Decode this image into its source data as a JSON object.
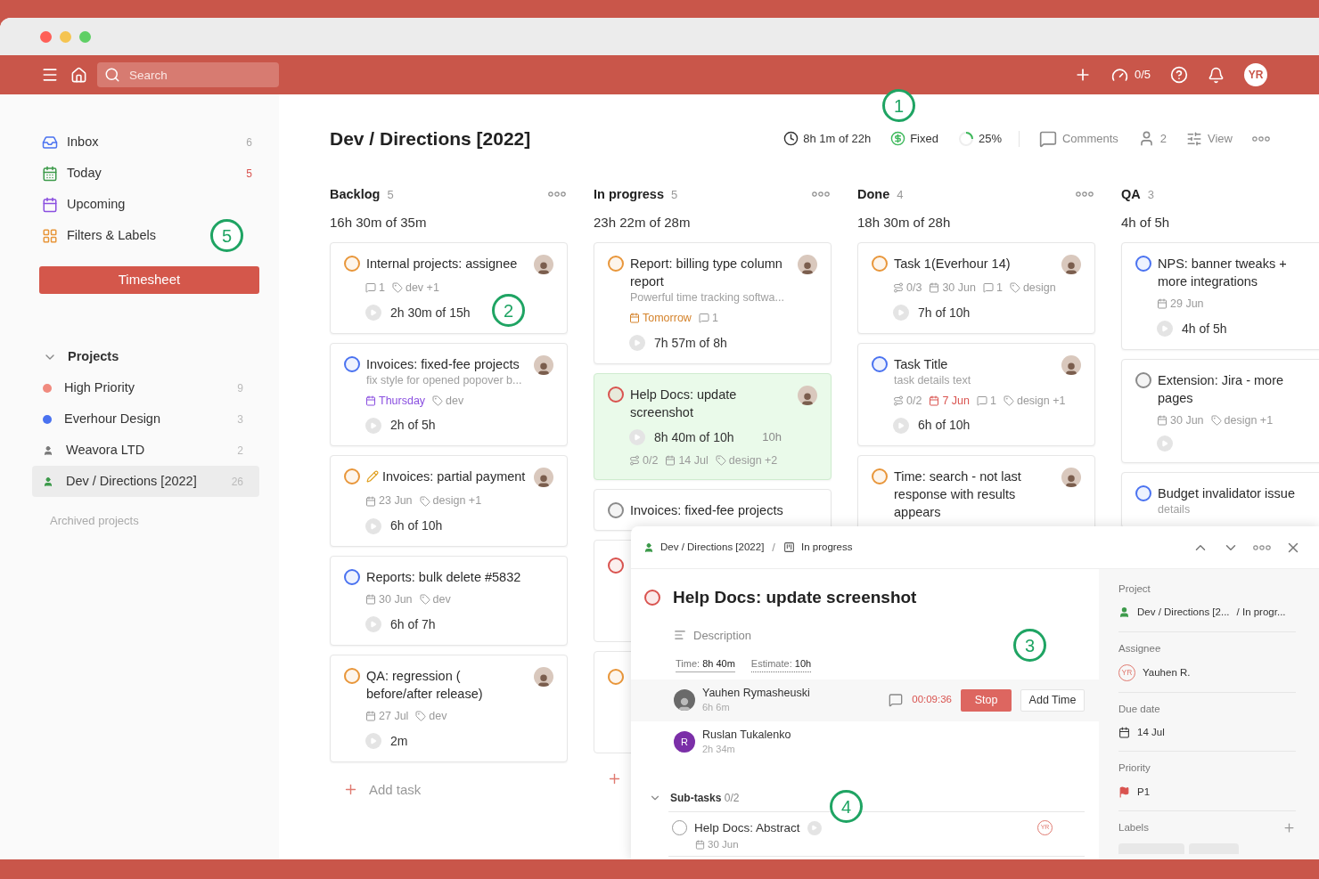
{
  "header": {
    "search_placeholder": "Search",
    "timers": "0/5",
    "avatar": "YR"
  },
  "sidebar": {
    "items": [
      {
        "kind": "inbox",
        "label": "Inbox",
        "count": "6",
        "alert": false
      },
      {
        "kind": "today",
        "label": "Today",
        "count": "5",
        "alert": true
      },
      {
        "kind": "upcoming",
        "label": "Upcoming"
      },
      {
        "kind": "filters",
        "label": "Filters & Labels"
      }
    ],
    "button": "Timesheet",
    "projects": {
      "title": "Projects",
      "expanded": true,
      "items": [
        {
          "kind": "dot",
          "label": "High Priority",
          "count": "9",
          "color": "#f08a7e",
          "selected": false
        },
        {
          "kind": "dot",
          "label": "Everhour Design",
          "count": "3",
          "color": "#4a72f0",
          "selected": false
        },
        {
          "kind": "person",
          "label": "Weavora LTD",
          "count": "2",
          "color": "#7a7a7a",
          "selected": false
        },
        {
          "kind": "person",
          "label": "Dev / Directions [2022]",
          "count": "26",
          "color": "#3c9a4a",
          "selected": true
        }
      ]
    },
    "archived": "Archived projects"
  },
  "project": {
    "title": "Dev / Directions [2022]",
    "stats": [
      {
        "kind": "time",
        "text": "8h 1m of 22h"
      },
      {
        "kind": "billing",
        "text": "Fixed"
      },
      {
        "kind": "progress",
        "text": "25%",
        "level": 0.25
      },
      {
        "kind": "comments",
        "text": "Comments"
      },
      {
        "kind": "members",
        "text": "2"
      },
      {
        "kind": "view",
        "text": "View"
      }
    ]
  },
  "columns": [
    {
      "title": "Backlog",
      "count": "5",
      "total": "16h 30m of 35m",
      "add_label": "Add task",
      "cards": [
        {
          "kind": "meta-first",
          "title": "Internal projects: assignee",
          "color": "#e8963a",
          "selected": false,
          "assigned": true,
          "meta": [
            {
              "kind": "comments",
              "text": "1"
            },
            {
              "kind": "tag",
              "text": "dev +1"
            }
          ],
          "timer": true,
          "time": "2h 30m of 15h"
        },
        {
          "kind": "meta-first",
          "title": "Invoices: fixed-fee projects",
          "subtitle": "fix style for opened popover b...",
          "color": "#4a72f0",
          "selected": false,
          "assigned": true,
          "meta": [
            {
              "kind": "date",
              "text": "Thursday",
              "color": "#8a4fe0"
            },
            {
              "kind": "tag",
              "text": "dev"
            }
          ],
          "timer": true,
          "time": "2h of 5h"
        },
        {
          "kind": "meta-first",
          "title": "Invoices: partial payment",
          "edited": true,
          "color": "#e8963a",
          "selected": false,
          "assigned": true,
          "meta": [
            {
              "kind": "date",
              "text": "23 Jun"
            },
            {
              "kind": "tag",
              "text": "design +1"
            }
          ],
          "timer": true,
          "time": "6h of 10h"
        },
        {
          "kind": "meta-first",
          "title": "Reports: bulk delete #5832",
          "color": "#4a72f0",
          "selected": false,
          "assigned": false,
          "meta": [
            {
              "kind": "date",
              "text": "30 Jun"
            },
            {
              "kind": "tag",
              "text": "dev"
            }
          ],
          "timer": true,
          "time": "6h of 7h"
        },
        {
          "kind": "meta-first",
          "title": "QA: regression ( before/after release)",
          "color": "#e8963a",
          "selected": false,
          "assigned": true,
          "meta": [
            {
              "kind": "date",
              "text": "27 Jul"
            },
            {
              "kind": "tag",
              "text": "dev"
            }
          ],
          "timer": true,
          "time": "2m"
        }
      ]
    },
    {
      "title": "In progress",
      "count": "5",
      "total": "23h 22m of 28m",
      "cards": [
        {
          "kind": "meta-first",
          "title": "Report: billing type column report",
          "subtitle": "Powerful time tracking softwa...",
          "color": "#e8963a",
          "selected": false,
          "assigned": true,
          "meta": [
            {
              "kind": "date",
              "text": "Tomorrow",
              "color": "#d4822a"
            },
            {
              "kind": "comments",
              "text": "1"
            }
          ],
          "timer": true,
          "time": "7h 57m of 8h"
        },
        {
          "kind": "timer-first",
          "title": "Help Docs: update screenshot",
          "color": "#d9534f",
          "selected": true,
          "assigned": true,
          "timer": true,
          "time": "8h 40m of 10h",
          "estimate": "10h",
          "meta": [
            {
              "kind": "subtasks",
              "text": "0/2"
            },
            {
              "kind": "date",
              "text": "14 Jul"
            },
            {
              "kind": "tag",
              "text": "design +2"
            }
          ]
        },
        {
          "kind": "meta-first",
          "title": "Invoices: fixed-fee projects",
          "color": "#8a8a8a",
          "selected": false,
          "assigned": false,
          "timer": false
        },
        {
          "kind": "stub",
          "color": "#d9534f",
          "selected": false
        },
        {
          "kind": "stub",
          "color": "#e8963a",
          "selected": false
        }
      ]
    },
    {
      "title": "Done",
      "count": "4",
      "total": "18h 30m of 28h",
      "cards": [
        {
          "kind": "meta-first",
          "title": "Task 1(Everhour 14)",
          "color": "#e8963a",
          "selected": false,
          "assigned": true,
          "meta": [
            {
              "kind": "subtasks",
              "text": "0/3"
            },
            {
              "kind": "date",
              "text": "30 Jun"
            },
            {
              "kind": "comments",
              "text": "1"
            },
            {
              "kind": "tag",
              "text": "design"
            }
          ],
          "timer": true,
          "time": "7h of 10h"
        },
        {
          "kind": "meta-first",
          "title": "Task Title",
          "subtitle": "task details text",
          "color": "#4a72f0",
          "selected": false,
          "assigned": true,
          "meta": [
            {
              "kind": "subtasks",
              "text": "0/2"
            },
            {
              "kind": "date",
              "text": "7 Jun",
              "color": "#d9534f"
            },
            {
              "kind": "comments",
              "text": "1"
            },
            {
              "kind": "tag",
              "text": "design +1"
            }
          ],
          "timer": true,
          "time": "6h of 10h"
        },
        {
          "kind": "meta-first",
          "title": "Time: search - not last response with results appears",
          "color": "#e8963a",
          "selected": false,
          "assigned": true,
          "timer": false
        }
      ]
    },
    {
      "title": "QA",
      "count": "3",
      "total": "4h of 5h",
      "cards": [
        {
          "kind": "meta-first",
          "title": "NPS: banner tweaks + more integrations",
          "color": "#4a72f0",
          "selected": false,
          "assigned": false,
          "meta": [
            {
              "kind": "date",
              "text": "29 Jun"
            }
          ],
          "timer": true,
          "time": "4h of 5h"
        },
        {
          "kind": "meta-first",
          "title": "Extension: Jira - more pages",
          "color": "#8a8a8a",
          "selected": false,
          "assigned": false,
          "meta": [
            {
              "kind": "date",
              "text": "30 Jun"
            },
            {
              "kind": "tag",
              "text": "design +1"
            }
          ],
          "timer": true
        },
        {
          "kind": "meta-first",
          "title": "Budget invalidator issue",
          "subtitle": "details",
          "color": "#4a72f0",
          "selected": false,
          "assigned": false,
          "timer": false
        }
      ]
    }
  ],
  "detail": {
    "breadcrumb": [
      "Dev / Directions [2022]",
      "In progress"
    ],
    "separator": "/",
    "title": "Help Docs: update screenshot",
    "description": "Description",
    "time_label": "Time:",
    "time": "8h 40m",
    "estimate_label": "Estimate:",
    "estimate": "10h",
    "people": [
      {
        "name": "Yauhen Rymasheuski",
        "time": "6h 6m",
        "active": true,
        "timer": "00:09:36"
      },
      {
        "name": "Ruslan Tukalenko",
        "time": "2h 34m",
        "active": false,
        "initial": "R"
      }
    ],
    "stop": "Stop",
    "add_time": "Add Time",
    "subtasks": {
      "title": "Sub-tasks",
      "count": "0/2",
      "expanded": true,
      "items": [
        {
          "title": "Help Docs: Abstract",
          "checked": false,
          "date": "30 Jun",
          "assignee": "YR"
        }
      ]
    },
    "fields": [
      {
        "kind": "project",
        "label": "Project",
        "value": "Dev / Directions [2...",
        "value2": "/ In progr..."
      },
      {
        "kind": "assignee",
        "label": "Assignee",
        "value": "Yauhen R.",
        "initials": "YR"
      },
      {
        "kind": "date",
        "label": "Due date",
        "value": "14 Jul"
      },
      {
        "kind": "priority",
        "label": "Priority",
        "value": "P1"
      },
      {
        "kind": "labels",
        "label": "Labels"
      }
    ]
  },
  "callouts": [
    "1",
    "2",
    "3",
    "4",
    "5"
  ]
}
